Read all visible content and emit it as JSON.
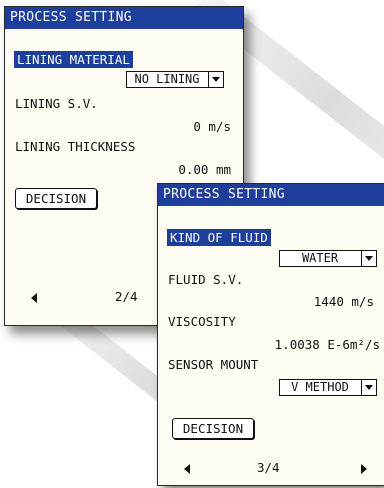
{
  "screen_back": {
    "title": "PROCESS SETTING",
    "section_label": "LINING MATERIAL",
    "lining_material_value": "NO LINING",
    "lining_sv_label": "LINING S.V.",
    "lining_sv_value": "0 m/s",
    "lining_thickness_label": "LINING THICKNESS",
    "lining_thickness_value": "0.00 mm",
    "decision_label": "DECISION",
    "page": "2/4"
  },
  "screen_front": {
    "title": "PROCESS SETTING",
    "section_label": "KIND OF FLUID",
    "fluid_value": "WATER",
    "fluid_sv_label": "FLUID S.V.",
    "fluid_sv_value": "1440 m/s",
    "viscosity_label": "VISCOSITY",
    "viscosity_value": "1.0038 E-6m²/s",
    "sensor_mount_label": "SENSOR MOUNT",
    "sensor_mount_value": "V METHOD",
    "decision_label": "DECISION",
    "page": "3/4"
  },
  "colors": {
    "title_bar": "#1d3e9a",
    "highlight": "#1d3e9a",
    "panel_bg": "#fffdf3"
  },
  "icons": [
    "select-arrow-icon",
    "nav-left-icon",
    "nav-right-icon"
  ]
}
